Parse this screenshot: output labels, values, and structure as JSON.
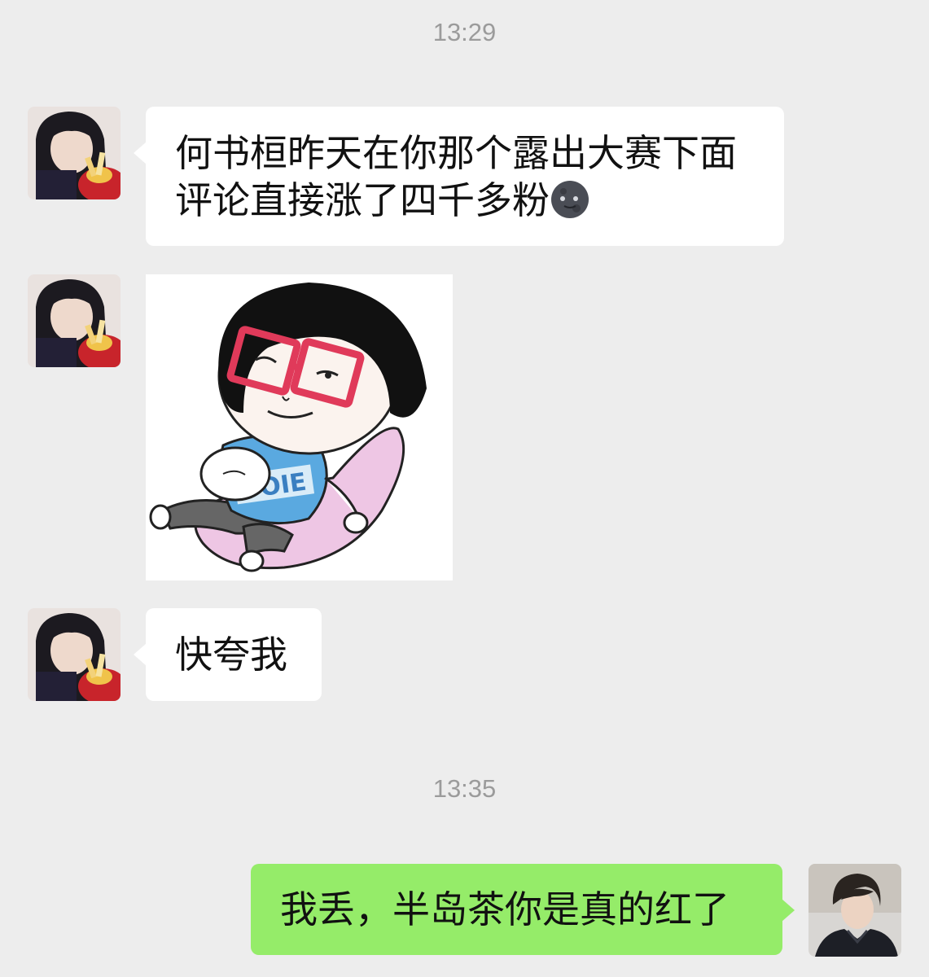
{
  "chat": {
    "timestamps": [
      "13:29",
      "13:35"
    ],
    "messages": [
      {
        "sender": "contact",
        "type": "text",
        "lines": [
          "何书桓昨天在你那个露出大赛下面",
          "评论直接涨了四千多粉"
        ],
        "emoji": "new-moon-face-icon"
      },
      {
        "sender": "contact",
        "type": "sticker",
        "sticker": "cartoon-girl-red-glasses-sticker",
        "sticker_text": "OIE"
      },
      {
        "sender": "contact",
        "type": "text",
        "text": "快夸我"
      },
      {
        "sender": "me",
        "type": "text",
        "text": "我丢，半岛茶你是真的红了"
      }
    ]
  },
  "colors": {
    "background": "#ededed",
    "incoming_bubble": "#ffffff",
    "outgoing_bubble": "#95ec69",
    "timestamp_text": "#9b9b9b",
    "message_text": "#111111"
  }
}
